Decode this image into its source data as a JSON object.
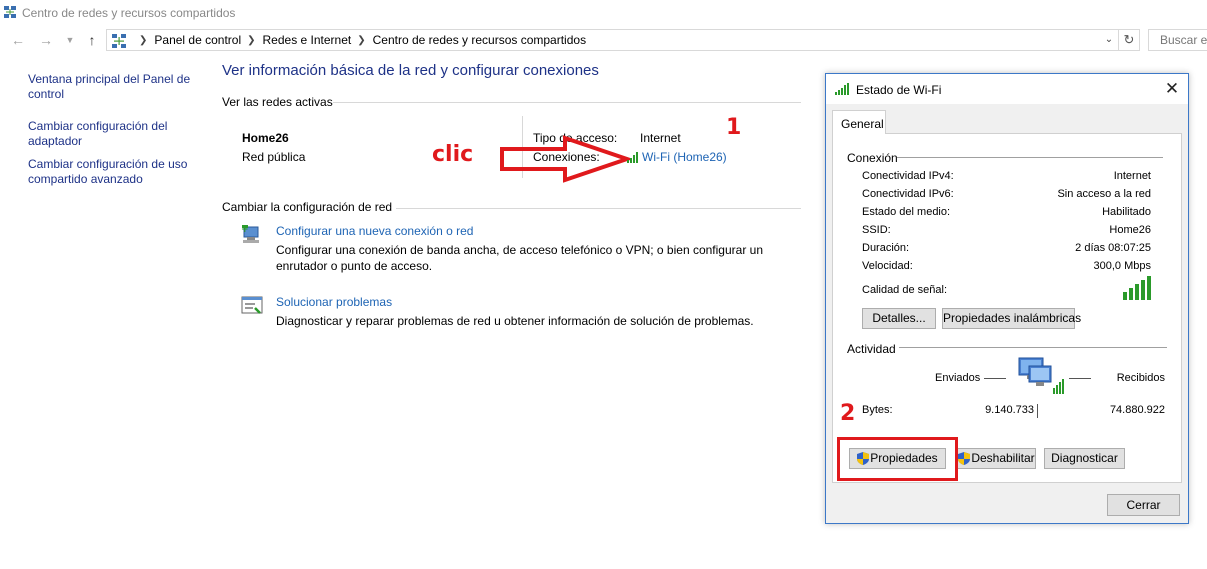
{
  "window": {
    "title": "Centro de redes y recursos compartidos"
  },
  "nav": {
    "back_icon": "back-arrow-icon",
    "forward_icon": "forward-arrow-icon",
    "recent_icon": "chevron-down-icon",
    "up_icon": "up-arrow-icon",
    "breadcrumbs": [
      "Panel de control",
      "Redes e Internet",
      "Centro de redes y recursos compartidos"
    ],
    "search_placeholder": "Buscar en"
  },
  "sidebar": {
    "items": [
      {
        "label": "Ventana principal del Panel de control"
      },
      {
        "label": "Cambiar configuración del adaptador"
      },
      {
        "label": "Cambiar configuración de uso compartido avanzado"
      }
    ]
  },
  "main": {
    "title": "Ver información básica de la red y configurar conexiones",
    "active_networks_label": "Ver las redes activas",
    "network": {
      "name": "Home26",
      "profile": "Red pública",
      "access_type_label": "Tipo de acceso:",
      "access_type_value": "Internet",
      "connections_label": "Conexiones:",
      "connections_value": "Wi-Fi (Home26)"
    },
    "change_settings_label": "Cambiar la configuración de red",
    "tasks": [
      {
        "link": "Configurar una nueva conexión o red",
        "desc": "Configurar una conexión de banda ancha, de acceso telefónico o VPN; o bien configurar un enrutador o punto de acceso."
      },
      {
        "link": "Solucionar problemas",
        "desc": "Diagnosticar y reparar problemas de red u obtener información de solución de problemas."
      }
    ]
  },
  "annotations": {
    "clic": "clic",
    "step1": "1",
    "step2": "2",
    "color": "#e0191c"
  },
  "dialog": {
    "title": "Estado de Wi-Fi",
    "tab": "General",
    "connection_group": "Conexión",
    "rows": [
      {
        "label": "Conectividad IPv4:",
        "value": "Internet"
      },
      {
        "label": "Conectividad IPv6:",
        "value": "Sin acceso a la red"
      },
      {
        "label": "Estado del medio:",
        "value": "Habilitado"
      },
      {
        "label": "SSID:",
        "value": "Home26"
      },
      {
        "label": "Duración:",
        "value": "2 días 08:07:25"
      },
      {
        "label": "Velocidad:",
        "value": "300,0 Mbps"
      }
    ],
    "signal_label": "Calidad de señal:",
    "signal_bars": 5,
    "details_button": "Detalles...",
    "wireless_props_button": "Propiedades inalámbricas",
    "activity_group": "Actividad",
    "sent_label": "Enviados",
    "received_label": "Recibidos",
    "bytes_label": "Bytes:",
    "bytes_sent": "9.140.733",
    "bytes_received": "74.880.922",
    "properties_button": "Propiedades",
    "disable_button": "Deshabilitar",
    "diagnose_button": "Diagnosticar",
    "close_button": "Cerrar"
  },
  "colors": {
    "link": "#1e64b4",
    "title": "#1e3287",
    "accent_border": "#3c78c8"
  }
}
